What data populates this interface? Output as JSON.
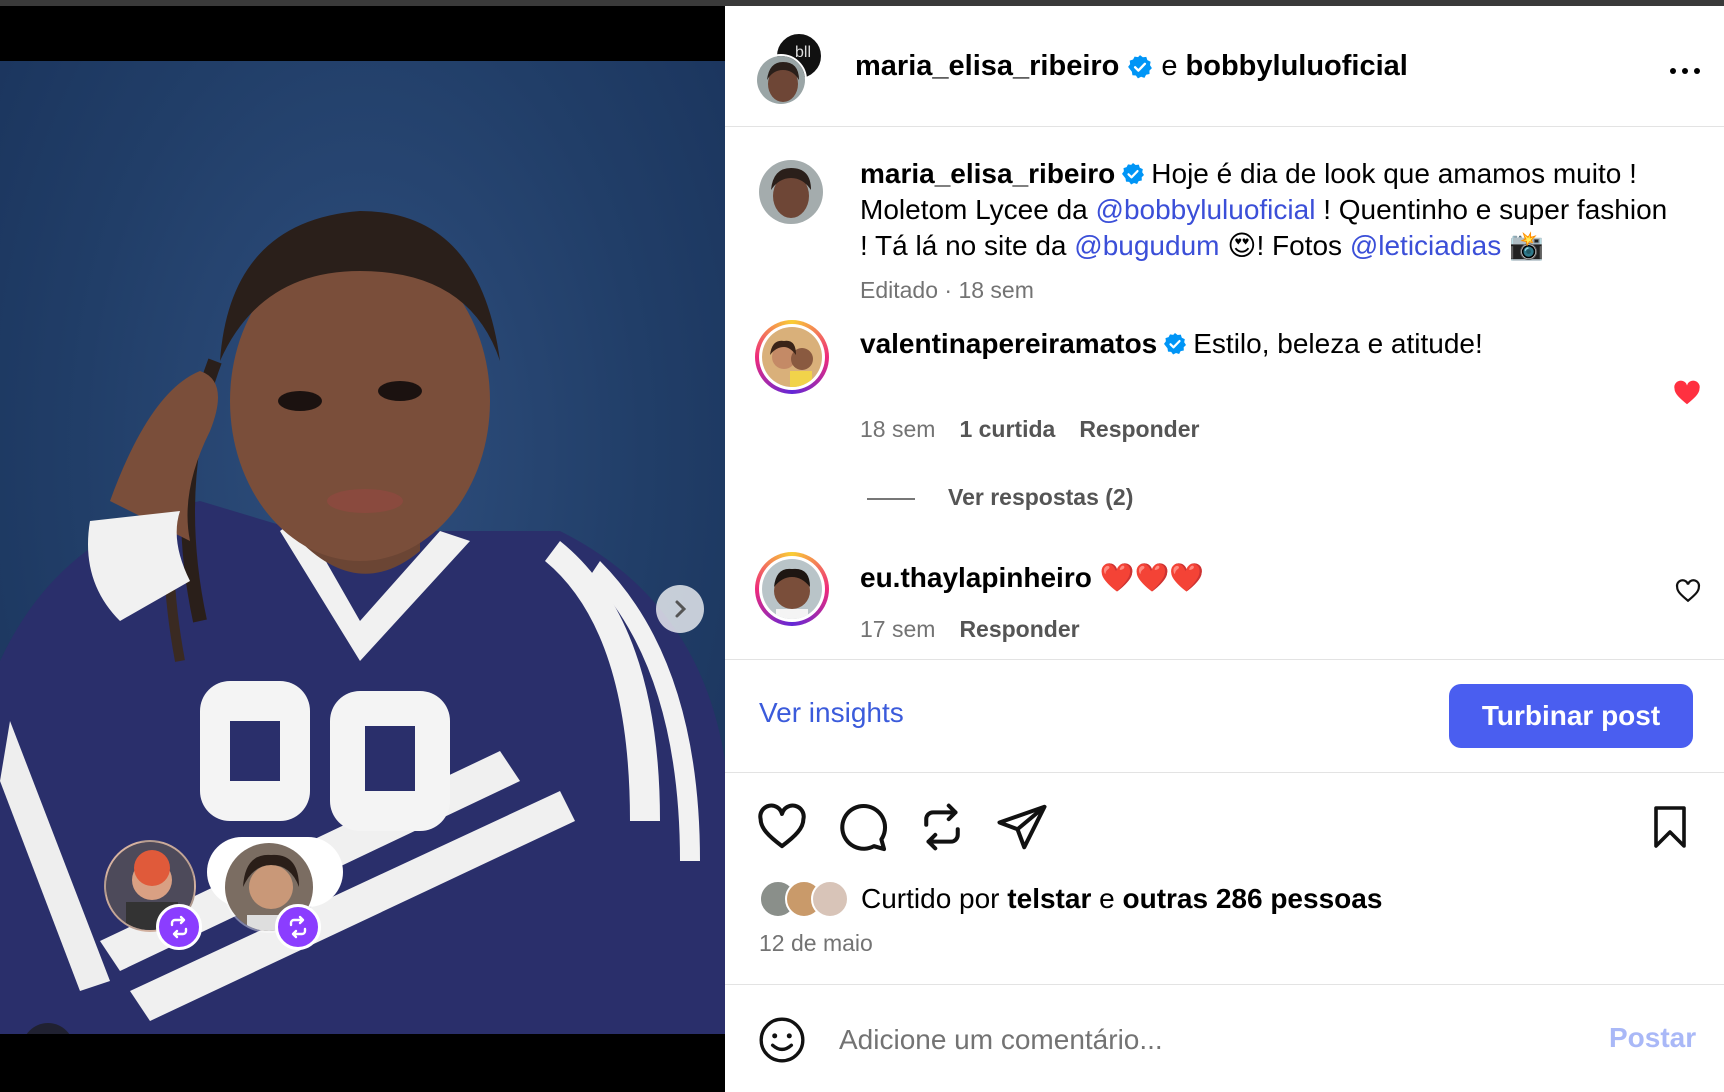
{
  "header": {
    "author": "maria_elisa_ribeiro",
    "conjunction": "e",
    "collaborator": "bobbyluluoficial",
    "back_avatar_text": "bll"
  },
  "caption": {
    "username": "maria_elisa_ribeiro",
    "part1": "Hoje é dia de look que amamos muito ! Moletom Lycee da ",
    "mention1": "@bobbyluluoficial",
    "part2": " ! Quentinho e super fashion ! Tá lá no site da ",
    "mention2": "@bugudum",
    "emoji1": "😍",
    "part3": "! Fotos ",
    "mention3": "@leticiadias",
    "emoji2": "📸",
    "meta": "Editado · 18 sem"
  },
  "comments": [
    {
      "username": "valentinapereiramatos",
      "text": "Estilo, beleza e atitude!",
      "age": "18 sem",
      "likes": "1 curtida",
      "reply": "Responder",
      "liked": true,
      "view_replies": "Ver respostas (2)"
    },
    {
      "username": "eu.thaylapinheiro",
      "text": "❤️❤️❤️",
      "age": "17 sem",
      "reply": "Responder",
      "liked": false
    }
  ],
  "insights_label": "Ver insights",
  "boost_label": "Turbinar post",
  "likes": {
    "prefix": "Curtido por",
    "user": "telstar",
    "conj": "e",
    "others": "outras 286 pessoas"
  },
  "date": "12 de maio",
  "comment_box": {
    "placeholder": "Adicione um comentário...",
    "post_label": "Postar"
  },
  "media": {
    "reaction": "❤",
    "carousel_count": 9,
    "carousel_active": 0
  },
  "colors": {
    "accent": "#4a5ef0",
    "mention": "#3b4fd8",
    "verified": "#0095f6",
    "like": "#ff3040",
    "repost_badge": "#8b3dff"
  }
}
